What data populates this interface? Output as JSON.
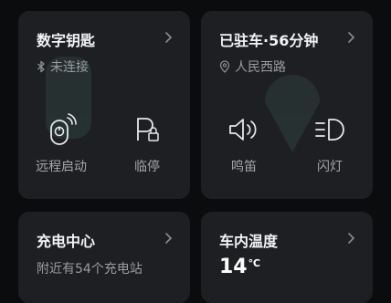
{
  "digital_key": {
    "title": "数字钥匙",
    "status": "未连接",
    "icons": {
      "status": "bluetooth-icon",
      "chevron": "chevron-right-icon"
    },
    "actions": [
      {
        "label": "远程启动",
        "icon": "remote-start-icon"
      },
      {
        "label": "临停",
        "icon": "temp-parking-lock-icon"
      }
    ]
  },
  "parking": {
    "title": "已驻车·56分钟",
    "location": "人民西路",
    "icons": {
      "location": "location-pin-icon",
      "chevron": "chevron-right-icon"
    },
    "actions": [
      {
        "label": "鸣笛",
        "icon": "horn-icon"
      },
      {
        "label": "闪灯",
        "icon": "flash-lights-icon"
      }
    ]
  },
  "charging": {
    "title": "充电中心",
    "subtitle": "附近有54个充电站"
  },
  "cabin_temp": {
    "title": "车内温度",
    "value": "14",
    "unit": "℃"
  },
  "colors": {
    "background": "#0b0c0e",
    "card": "#1e1f22",
    "text_primary": "#f2f3f5",
    "text_secondary": "#9a9ca1"
  }
}
